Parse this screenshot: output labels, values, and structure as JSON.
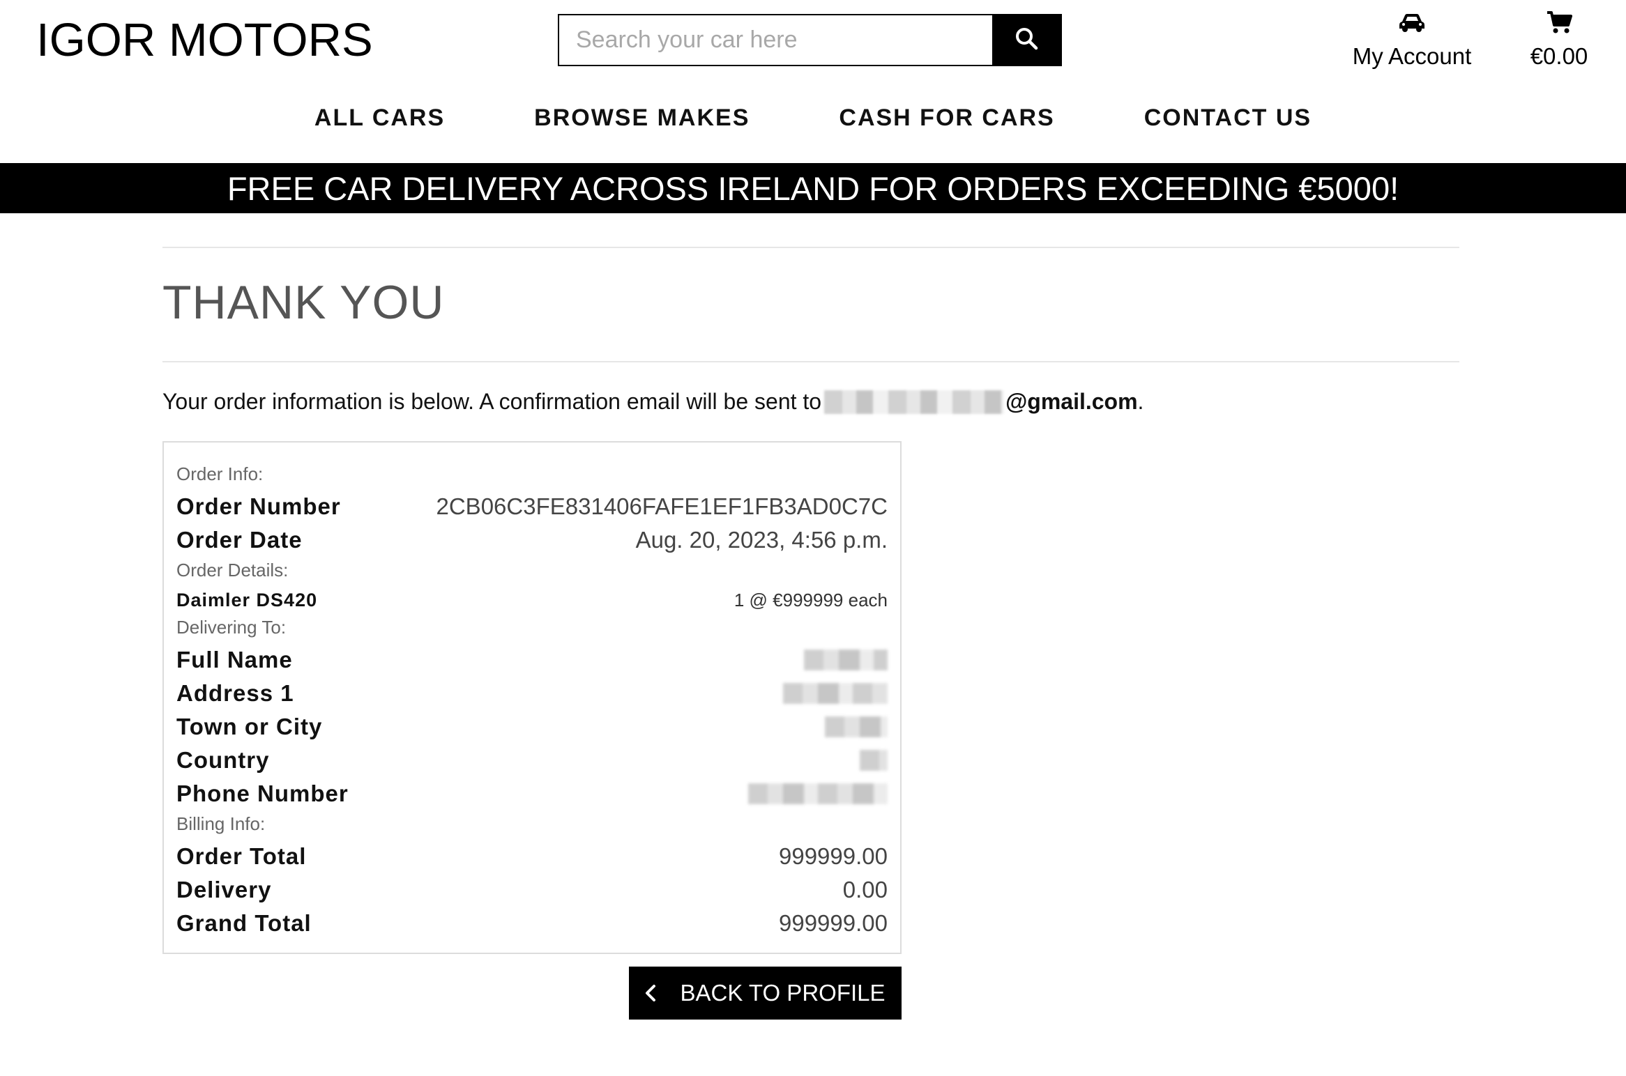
{
  "header": {
    "logo": "IGOR MOTORS",
    "search_placeholder": "Search your car here",
    "account_label": "My Account",
    "cart_total": "€0.00"
  },
  "nav": {
    "items": [
      {
        "label": "ALL CARS"
      },
      {
        "label": "BROWSE MAKES"
      },
      {
        "label": "CASH FOR CARS"
      },
      {
        "label": "CONTACT US"
      }
    ]
  },
  "banner": {
    "text": "FREE CAR DELIVERY ACROSS IRELAND FOR ORDERS EXCEEDING €5000!"
  },
  "page": {
    "title": "THANK YOU",
    "intro_text": "Your order information is below. A confirmation email will be sent to",
    "email_domain": "@gmail.com",
    "intro_end": "."
  },
  "order": {
    "info_label": "Order Info:",
    "number_key": "Order Number",
    "number_value": "2CB06C3FE831406FAFE1EF1FB3AD0C7C",
    "date_key": "Order Date",
    "date_value": "Aug. 20, 2023, 4:56 p.m.",
    "details_label": "Order Details:",
    "item_name": "Daimler DS420",
    "item_qty_price": "1 @ €999999 each",
    "delivering_label": "Delivering To:",
    "full_name_key": "Full Name",
    "address1_key": "Address 1",
    "town_key": "Town or City",
    "country_key": "Country",
    "phone_key": "Phone Number",
    "billing_label": "Billing Info:",
    "order_total_key": "Order Total",
    "order_total_value": "999999.00",
    "delivery_key": "Delivery",
    "delivery_value": "0.00",
    "grand_total_key": "Grand Total",
    "grand_total_value": "999999.00"
  },
  "actions": {
    "back_label": "BACK TO PROFILE"
  },
  "icons": {
    "search": "search-icon",
    "account": "car-icon",
    "cart": "cart-icon",
    "back": "chevron-left-icon"
  },
  "colors": {
    "primary": "#000000",
    "muted_text": "#666666",
    "border": "#dcdcdc"
  }
}
